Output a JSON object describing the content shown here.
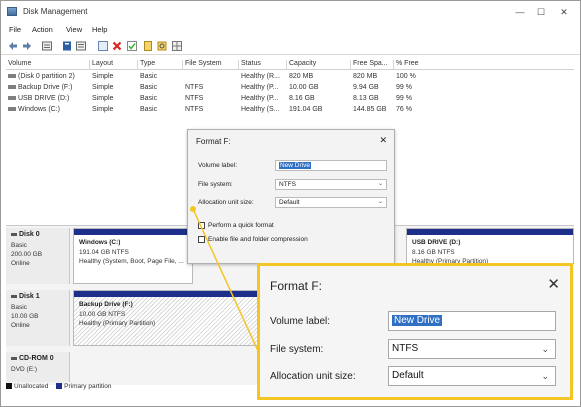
{
  "window": {
    "title": "Disk Management"
  },
  "window_controls": {
    "minimize": "—",
    "maximize": "☐",
    "close": "✕"
  },
  "menu": [
    "File",
    "Action",
    "View",
    "Help"
  ],
  "toolbar_icons": [
    "back-icon",
    "forward-icon",
    "list-icon",
    "help-icon",
    "properties-icon",
    "delete-icon",
    "check-icon",
    "new-icon",
    "search-icon",
    "view-icon"
  ],
  "volumes": {
    "headers": [
      "Volume",
      "Layout",
      "Type",
      "File System",
      "Status",
      "Capacity",
      "Free Spa...",
      "% Free"
    ],
    "rows": [
      [
        "(Disk 0 partition 2)",
        "Simple",
        "Basic",
        "",
        "Healthy (R...",
        "820 MB",
        "820 MB",
        "100 %"
      ],
      [
        "Backup Drive (F:)",
        "Simple",
        "Basic",
        "NTFS",
        "Healthy (P...",
        "10.00 GB",
        "9.94 GB",
        "99 %"
      ],
      [
        "USB DRIVE (D:)",
        "Simple",
        "Basic",
        "NTFS",
        "Healthy (P...",
        "8.16 GB",
        "8.13 GB",
        "99 %"
      ],
      [
        "Windows (C:)",
        "Simple",
        "Basic",
        "NTFS",
        "Healthy (S...",
        "191.04 GB",
        "144.85 GB",
        "76 %"
      ]
    ]
  },
  "format_dialog": {
    "title": "Format F:",
    "volume_label_label": "Volume label:",
    "volume_label_value": "New Drive",
    "file_system_label": "File system:",
    "file_system_value": "NTFS",
    "allocation_label": "Allocation unit size:",
    "allocation_value": "Default",
    "quick_format": "Perform a quick format",
    "compression": "Enable file and folder compression"
  },
  "disks": [
    {
      "name": "Disk 0",
      "lines": [
        "Basic",
        "200.00 GB",
        "Online"
      ],
      "partitions": [
        {
          "name": "Windows (C:)",
          "size": "191.04 GB NTFS",
          "status": "Healthy (System, Boot, Page File, ..."
        },
        {
          "name": "USB DRIVE (D:)",
          "size": "8.16 GB NTFS",
          "status": "Healthy (Primary Partition)"
        }
      ]
    },
    {
      "name": "Disk 1",
      "lines": [
        "Basic",
        "10.00 GB",
        "Online"
      ],
      "partitions": [
        {
          "name": "Backup Drive (F:)",
          "size": "10.00 GB NTFS",
          "status": "Healthy (Primary Partition)"
        }
      ]
    },
    {
      "name": "CD-ROM 0",
      "lines": [
        "DVD (E:)"
      ]
    }
  ],
  "legend": {
    "unallocated": "Unallocated",
    "primary": "Primary partition"
  },
  "colors": {
    "primary_partition": "#1d2f8a",
    "unallocated": "#111111",
    "callout": "#f3c626",
    "selection": "#2f6fc4"
  }
}
